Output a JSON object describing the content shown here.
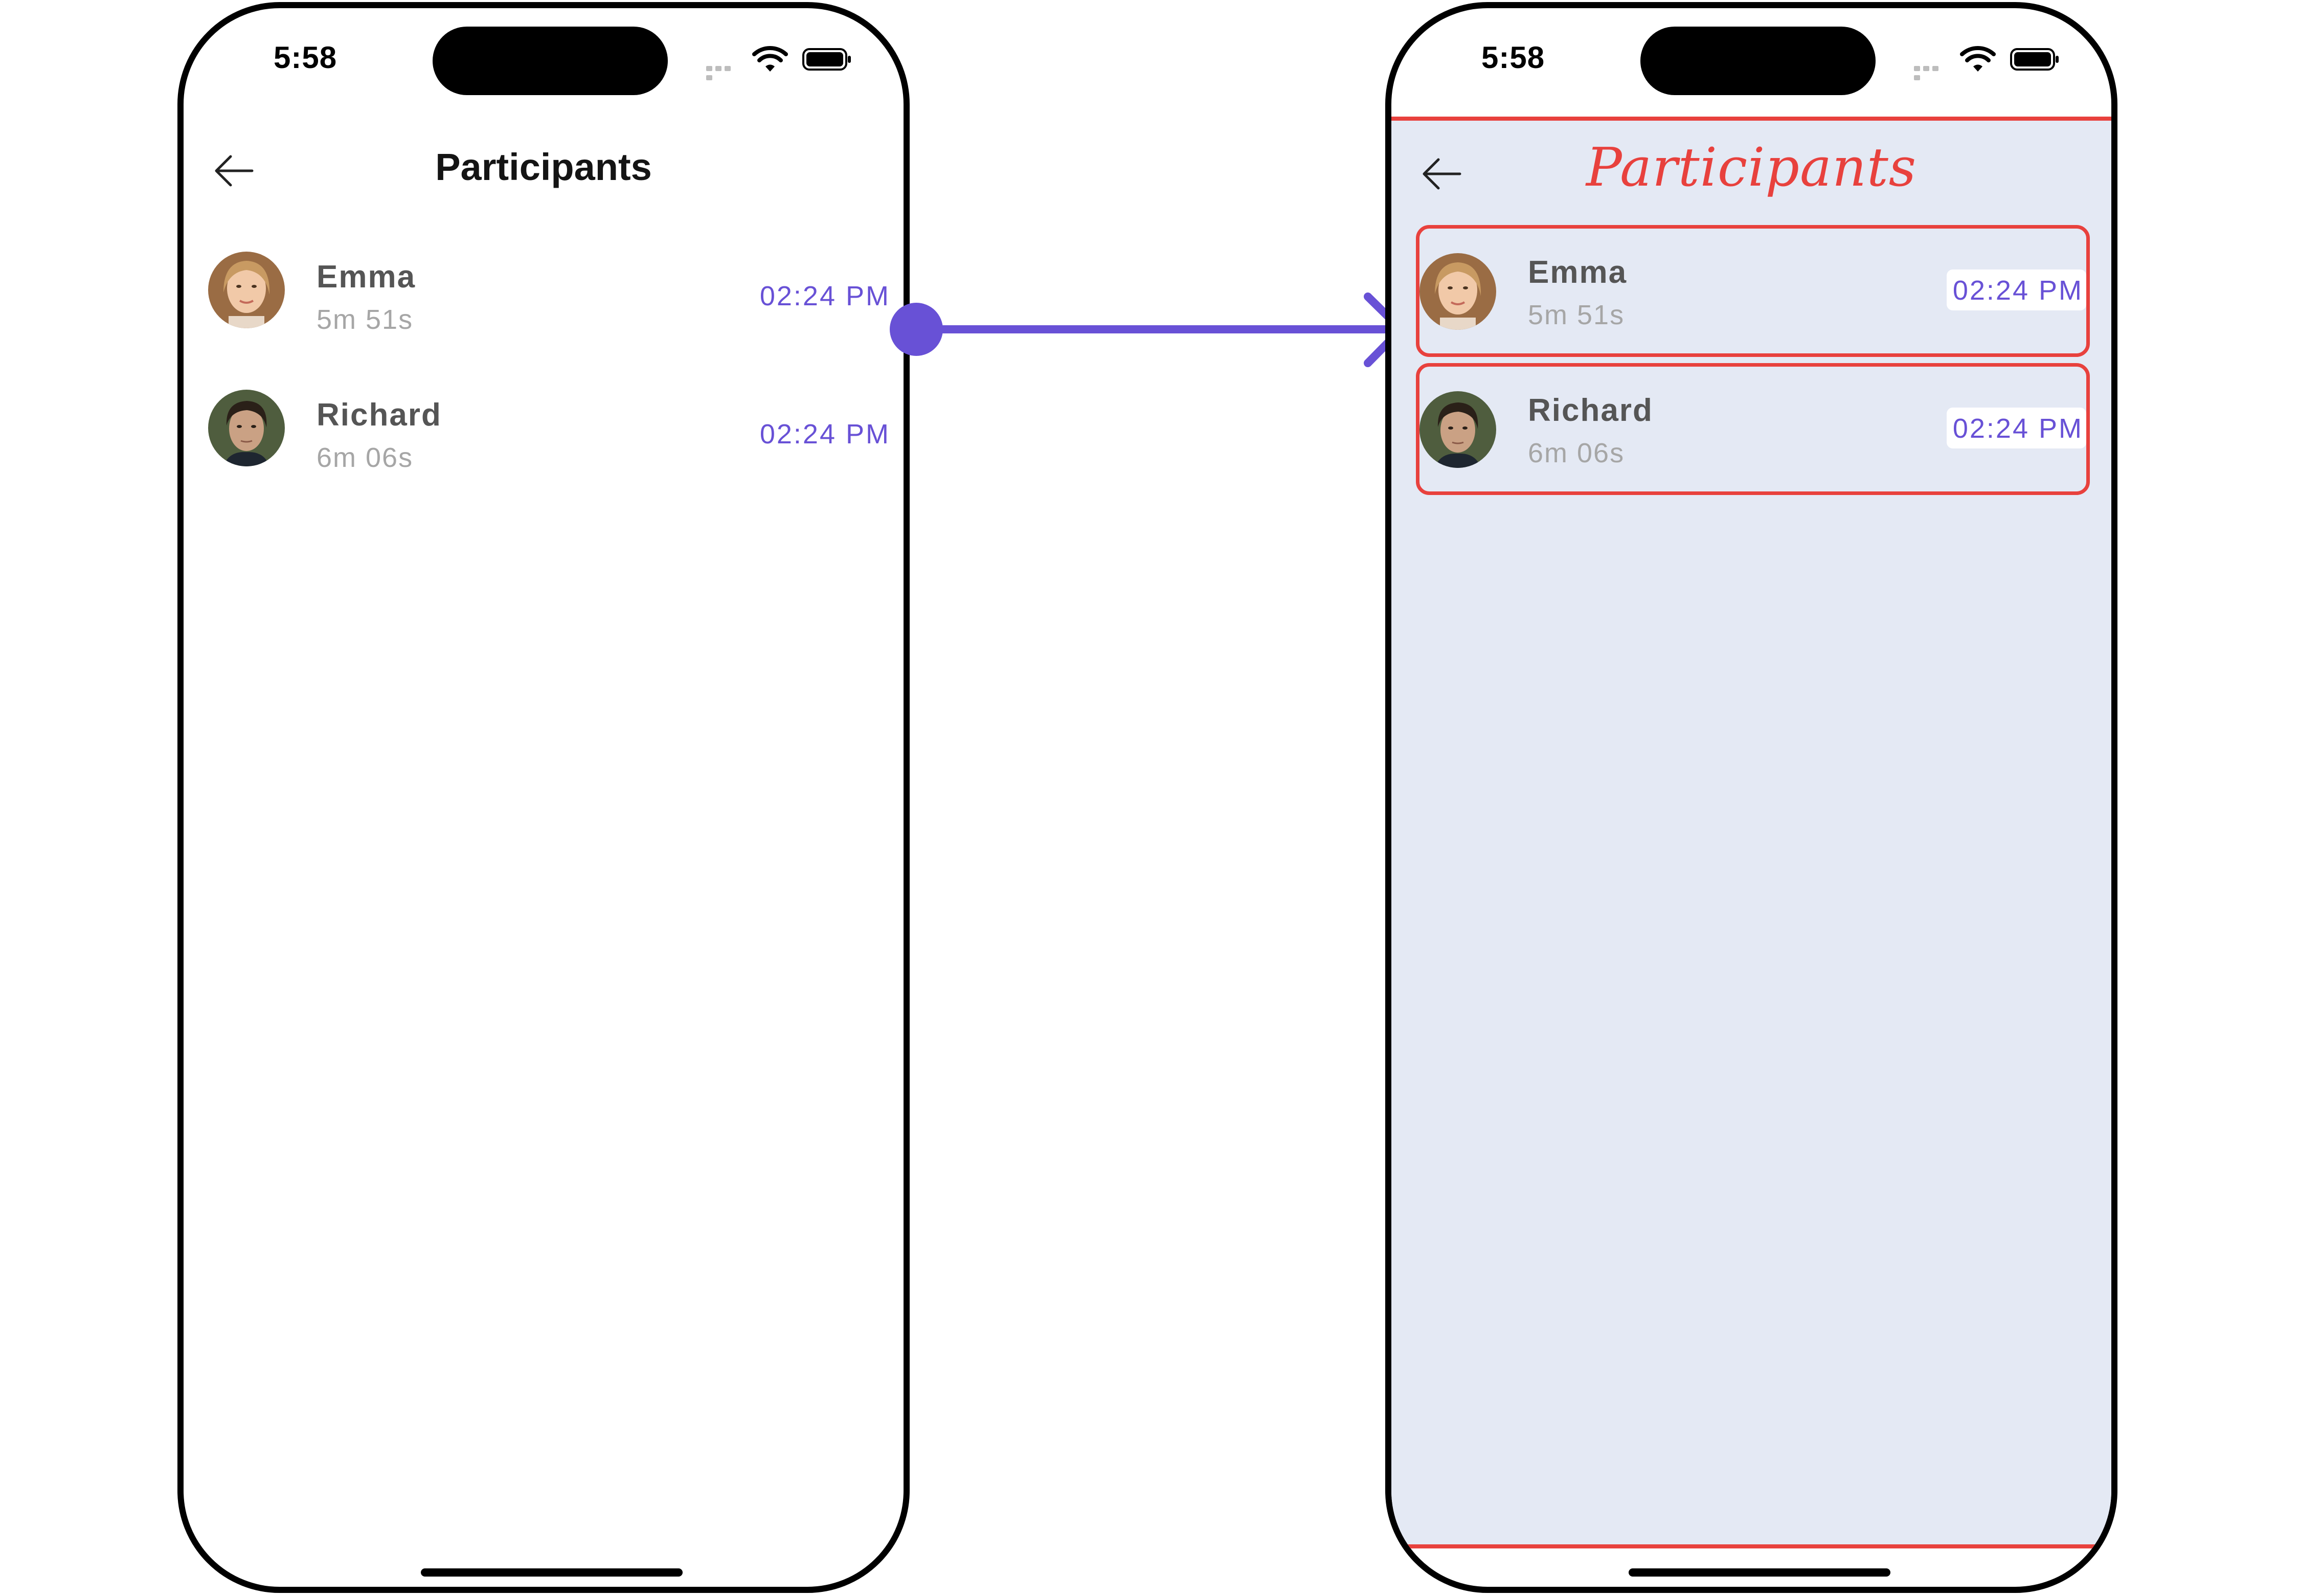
{
  "left_phone": {
    "status": {
      "time": "5:58"
    },
    "header": {
      "title": "Participants"
    },
    "participants": [
      {
        "name": "Emma",
        "duration": "5m 51s",
        "joined": "02:24 PM"
      },
      {
        "name": "Richard",
        "duration": "6m 06s",
        "joined": "02:24 PM"
      }
    ]
  },
  "right_phone": {
    "status": {
      "time": "5:58"
    },
    "header": {
      "title": "Participants"
    },
    "participants": [
      {
        "name": "Emma",
        "duration": "5m 51s",
        "joined": "02:24 PM"
      },
      {
        "name": "Richard",
        "duration": "6m 06s",
        "joined": "02:24 PM"
      }
    ]
  },
  "colors": {
    "accent": "#6851d6",
    "highlight": "#e8413d",
    "styled_background": "#e4e9f4",
    "name_text": "#555555",
    "secondary_text": "#a6a6a6"
  },
  "icons": {
    "back": "arrow-left-icon",
    "wifi": "wifi-icon",
    "battery": "battery-icon",
    "signal": "signal-dots-icon"
  }
}
